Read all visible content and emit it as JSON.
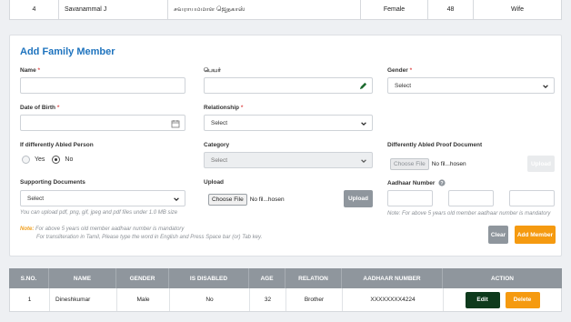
{
  "prev_row": {
    "sno": "4",
    "name": "Savanammal J",
    "name_tamil": "சவராயமமாள ஜெதகாஸ்",
    "gender": "Female",
    "age": "48",
    "relation": "Wife"
  },
  "form": {
    "title": "Add Family Member",
    "name": {
      "label": "Name",
      "required": "*",
      "value": ""
    },
    "name_tamil": {
      "label": "பெயர்",
      "value": ""
    },
    "gender": {
      "label": "Gender",
      "required": "*",
      "selected": "Select"
    },
    "dob": {
      "label": "Date of Birth",
      "required": "*",
      "value": ""
    },
    "relationship": {
      "label": "Relationship",
      "required": "*",
      "selected": "Select"
    },
    "disabled": {
      "label": "If differently Abled Person",
      "options": [
        "Yes",
        "No"
      ],
      "selected": "No"
    },
    "category": {
      "label": "Category",
      "selected": "Select"
    },
    "proof_doc": {
      "label": "Differently Abled Proof Document",
      "choose_label": "Choose File",
      "file_text": "No fil...hosen",
      "upload_label": "Upload"
    },
    "supporting": {
      "label": "Supporting Documents",
      "selected": "Select",
      "hint": "You can upload pdf, png, gif, jpeg and pdf files under 1.0 MB size"
    },
    "upload": {
      "label": "Upload",
      "choose_label": "Choose File",
      "file_text": "No fil...hosen",
      "upload_label": "Upload"
    },
    "aadhaar": {
      "label": "Aadhaar Number",
      "hint": "Note: For above 5 years old member aadhaar number is mandatory"
    },
    "note_prefix": "Note:",
    "note_line1": " For above 5 years old member aadhaar number is mandatory",
    "note_line2": "For transliteration in Tamil, Please type the word in English and Press Space bar (or) Tab key.",
    "clear_label": "Clear",
    "add_label": "Add Member"
  },
  "table": {
    "headers": [
      "S.NO.",
      "NAME",
      "GENDER",
      "IS DISABLED",
      "AGE",
      "RELATION",
      "AADHAAR NUMBER",
      "ACTION"
    ],
    "rows": [
      {
        "sno": "1",
        "name": "Dineshkumar",
        "gender": "Male",
        "disabled": "No",
        "age": "32",
        "relation": "Brother",
        "aadhaar": "XXXXXXXX4224",
        "edit": "Edit",
        "delete": "Delete"
      }
    ]
  },
  "colors": {
    "title_blue": "#1e73be",
    "edit_green": "#0e3a1c",
    "delete_orange": "#f59a10",
    "add_orange": "#f59a10",
    "clear_gray": "#8f969d",
    "header_gray": "#8f969d"
  },
  "icons": [
    "pencil-icon",
    "calendar-icon",
    "chevron-down-icon",
    "help-circle-icon"
  ]
}
